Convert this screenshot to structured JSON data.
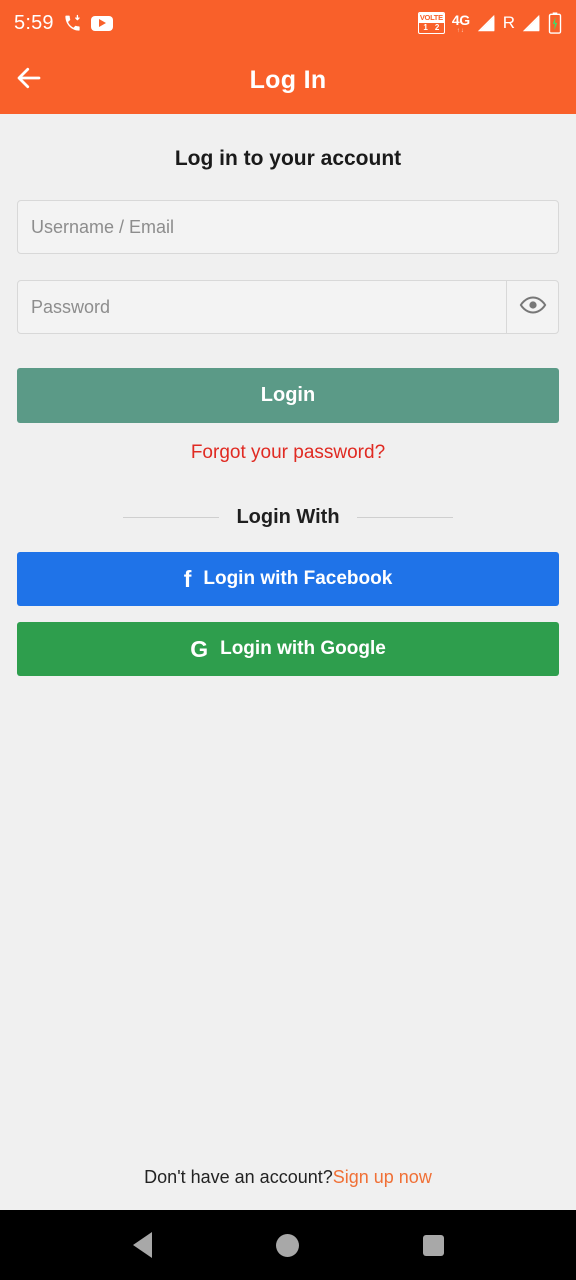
{
  "status_bar": {
    "time": "5:59",
    "icons": {
      "missed_call": "missed-call-icon",
      "youtube": "youtube-icon",
      "volte_label": "VOLTE",
      "volte_sim1": "1",
      "volte_sim2": "2",
      "network_type": "4G",
      "network_sub": "↑↓",
      "signal_1": "signal-bars-icon",
      "roaming": "R",
      "signal_2": "signal-bars-icon",
      "battery": "battery-charging-icon"
    },
    "background_color": "#f9602a"
  },
  "app_bar": {
    "back_label": "back-arrow",
    "title": "Log In",
    "background_color": "#f9602a",
    "title_color": "#ffffff"
  },
  "main": {
    "heading": "Log in to your account",
    "username_field": {
      "placeholder": "Username / Email",
      "value": ""
    },
    "password_field": {
      "placeholder": "Password",
      "value": "",
      "toggle_icon": "eye-icon"
    },
    "login_button": {
      "label": "Login",
      "color": "#5b9a87"
    },
    "forgot_password": {
      "label": "Forgot your password?",
      "color": "#e02a22"
    },
    "divider_label": "Login With",
    "facebook_button": {
      "glyph": "f",
      "label": "Login with Facebook",
      "color": "#1f73e8"
    },
    "google_button": {
      "glyph": "G",
      "label": "Login with Google",
      "color": "#2e9e4d"
    }
  },
  "footer": {
    "prompt": "Don't have an account?",
    "link_label": "Sign up now",
    "link_color": "#f07036"
  },
  "nav_bar": {
    "back": "nav-back-triangle",
    "home": "nav-home-circle",
    "recents": "nav-recents-square"
  }
}
